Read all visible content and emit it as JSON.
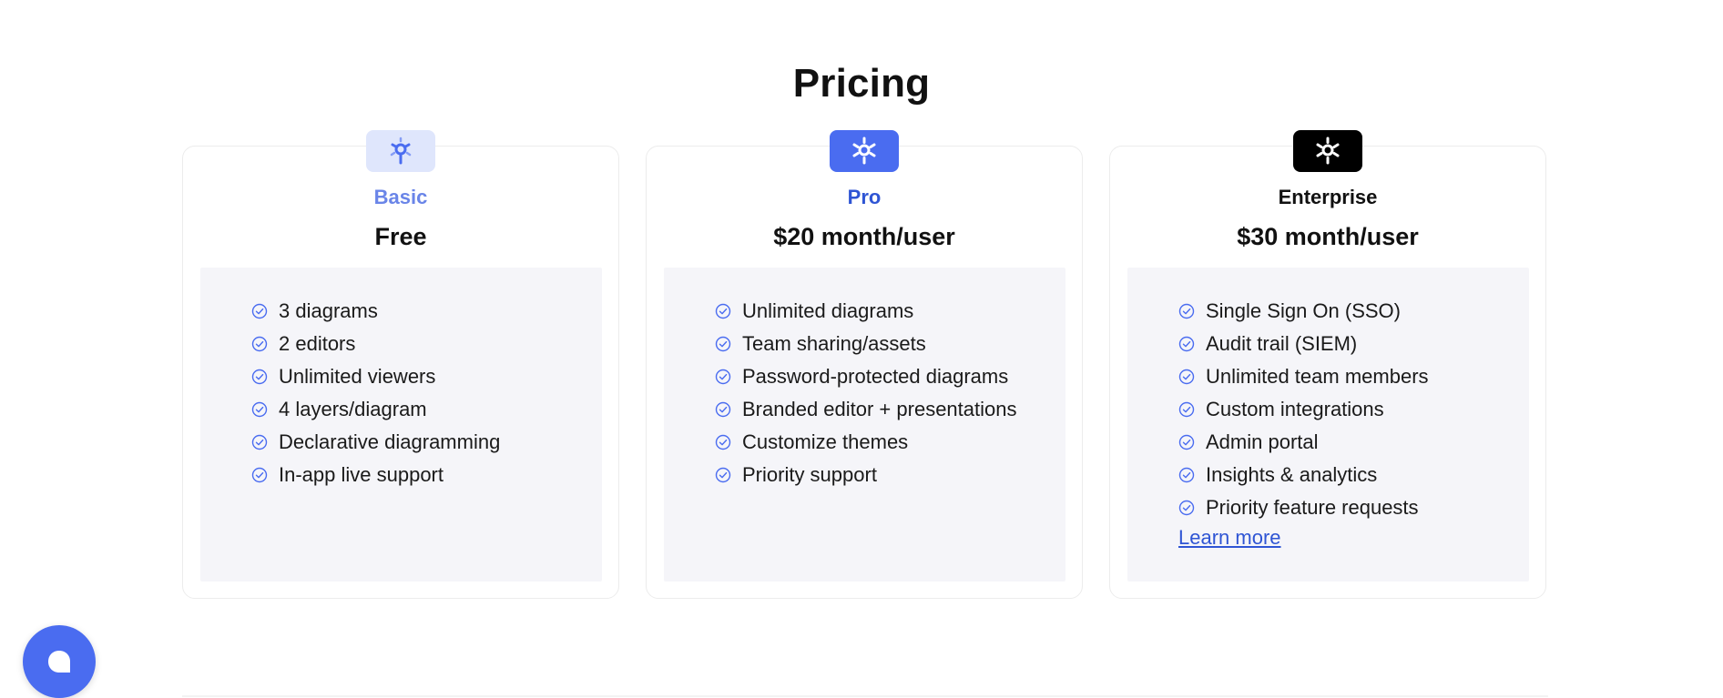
{
  "page": {
    "title": "Pricing"
  },
  "colors": {
    "accent": "#4a6cf0",
    "basic_badge": "#dfe6fc",
    "enterprise_badge": "#000000",
    "features_bg": "#f5f5f9",
    "check": "#4a6cf0"
  },
  "plans": [
    {
      "name": "Basic",
      "price": "Free",
      "icon": "logo-icon",
      "features": [
        "3 diagrams",
        "2 editors",
        "Unlimited viewers",
        "4 layers/diagram",
        "Declarative diagramming",
        "In-app live support"
      ]
    },
    {
      "name": "Pro",
      "price": "$20 month/user",
      "icon": "logo-icon",
      "features": [
        "Unlimited diagrams",
        "Team sharing/assets",
        "Password-protected diagrams",
        "Branded editor + presentations",
        "Customize themes",
        "Priority support"
      ]
    },
    {
      "name": "Enterprise",
      "price": "$30 month/user",
      "icon": "logo-icon",
      "features": [
        "Single Sign On (SSO)",
        "Audit trail (SIEM)",
        "Unlimited team members",
        "Custom integrations",
        "Admin portal",
        "Insights & analytics",
        "Priority feature requests"
      ],
      "link_label": "Learn more"
    }
  ],
  "chat": {
    "icon": "chat-bubble-icon"
  }
}
